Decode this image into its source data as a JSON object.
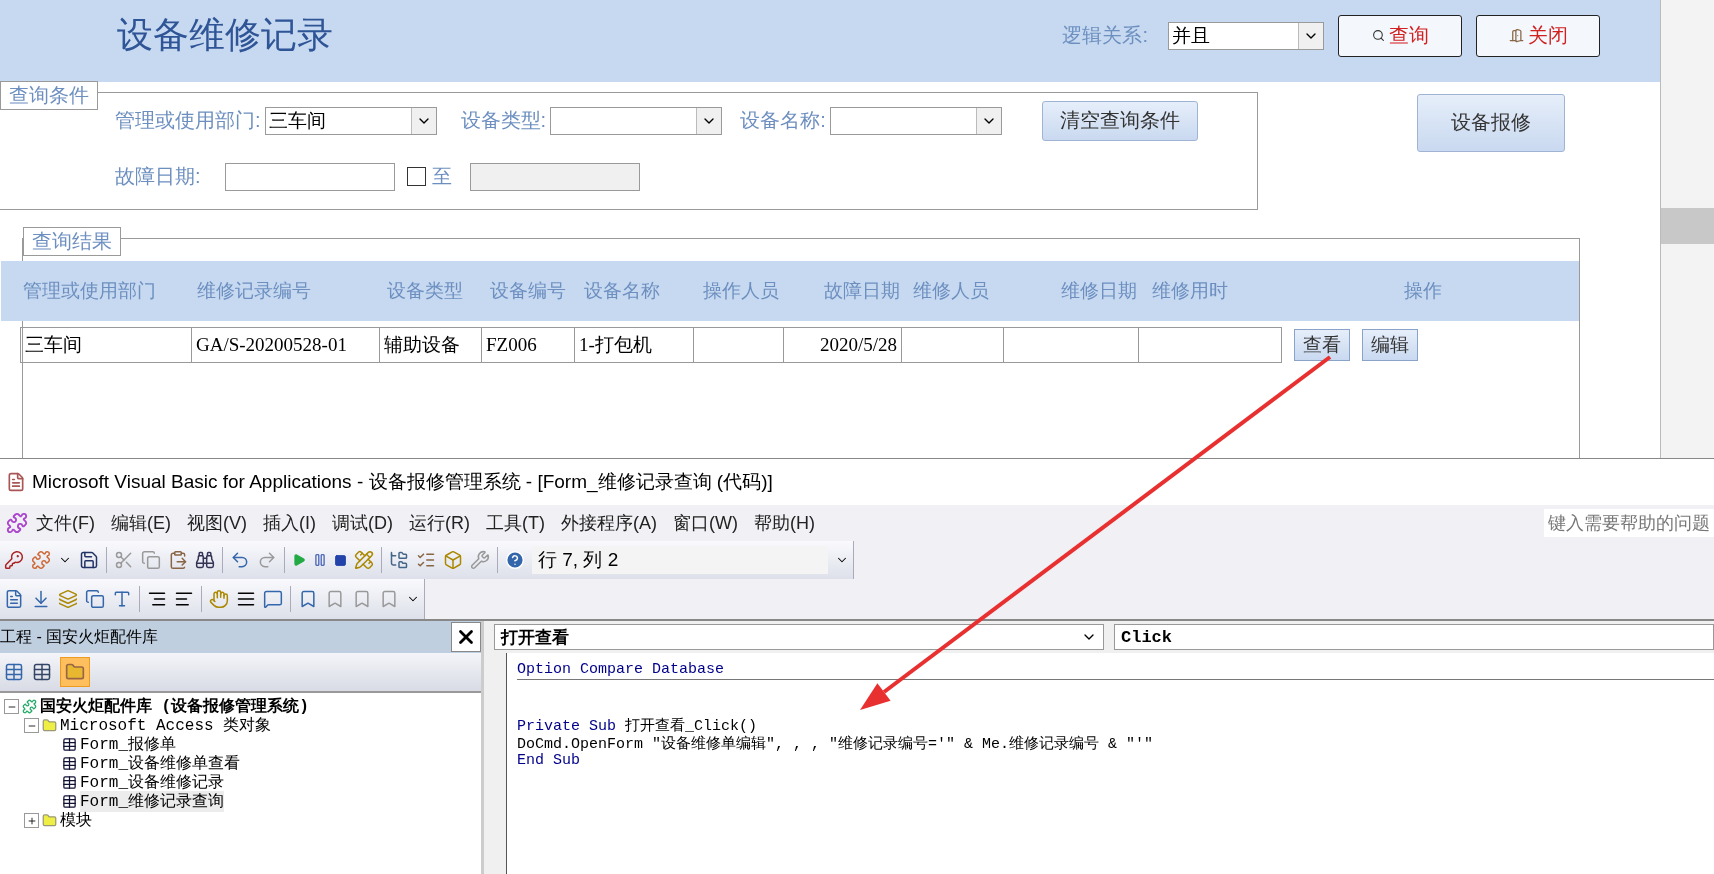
{
  "form": {
    "title": "设备维修记录",
    "logic_label": "逻辑关系:",
    "logic_value": "并且",
    "query_button": "查询",
    "close_button": "关闭",
    "criteria": {
      "legend": "查询条件",
      "dept_label": "管理或使用部门:",
      "dept_value": "三车间",
      "type_label": "设备类型:",
      "name_label": "设备名称:",
      "clear_button": "清空查询条件",
      "date_label": "故障日期:",
      "date_range_checked": false,
      "to_label": "至"
    },
    "report_button": "设备报修",
    "results": {
      "legend": "查询结果",
      "columns": [
        "管理或使用部门",
        "维修记录编号",
        "设备类型",
        "设备编号",
        "设备名称",
        "操作人员",
        "故障日期",
        "维修人员",
        "维修日期",
        "维修用时",
        "操作"
      ],
      "rows": [
        {
          "cells": [
            {
              "kind": "text",
              "text": "三车间"
            },
            {
              "kind": "text",
              "text": "GA/S-20200528-01"
            },
            {
              "kind": "text",
              "text": "辅助设备"
            },
            {
              "kind": "text",
              "text": "FZ006"
            },
            {
              "kind": "text",
              "text": "1-打包机"
            },
            {
              "kind": "text"
            },
            {
              "kind": "date",
              "text": "2020/5/28"
            },
            {
              "kind": "text"
            },
            {
              "kind": "text"
            },
            {
              "kind": "text"
            }
          ],
          "view_button": "查看",
          "edit_button": "编辑"
        }
      ]
    }
  },
  "vbe": {
    "title": "Microsoft Visual Basic for Applications - 设备报修管理系统 - [Form_维修记录查询 (代码)]",
    "menu": [
      "文件(F)",
      "编辑(E)",
      "视图(V)",
      "插入(I)",
      "调试(D)",
      "运行(R)",
      "工具(T)",
      "外接程序(A)",
      "窗口(W)",
      "帮助(H)"
    ],
    "help_box": "键入需要帮助的问题",
    "position": "行 7, 列 2",
    "project": {
      "title": "工程 - 国安火炬配件库",
      "tree": [
        {
          "label": "国安火炬配件库 (设备报修管理系统)",
          "kind": "project",
          "expanded": true,
          "selected": false,
          "children": [
            {
              "label": "Microsoft Access 类对象",
              "kind": "folder",
              "expanded": true,
              "selected": false,
              "children": [
                {
                  "label": "Form_报修单",
                  "kind": "form",
                  "selected": false
                },
                {
                  "label": "Form_设备维修单查看",
                  "kind": "form",
                  "selected": false
                },
                {
                  "label": "Form_设备维修记录",
                  "kind": "form",
                  "selected": false
                },
                {
                  "label": "Form_维修记录查询",
                  "kind": "form",
                  "selected": true
                }
              ]
            },
            {
              "label": "模块",
              "kind": "folder",
              "expanded": false,
              "selected": false
            }
          ]
        }
      ]
    },
    "code": {
      "object": "打开查看",
      "procedure": "Click",
      "lines": [
        {
          "kind": "code",
          "separator": true,
          "segments": [
            {
              "text": "Option Compare Database",
              "keyword": true
            }
          ]
        },
        {
          "kind": "blank"
        },
        {
          "kind": "blank"
        },
        {
          "kind": "code",
          "segments": [
            {
              "text": "Private Sub",
              "keyword": true
            },
            {
              "text": " 打开查看_Click()",
              "keyword": false
            }
          ]
        },
        {
          "kind": "code",
          "segments": [
            {
              "text": "DoCmd.OpenForm \"设备维修单编辑\", , , \"维修记录编号='\" & Me.维修记录编号 & \"'\"",
              "keyword": false
            }
          ]
        },
        {
          "kind": "code",
          "segments": [
            {
              "text": "End Sub",
              "keyword": true
            }
          ]
        }
      ]
    }
  }
}
